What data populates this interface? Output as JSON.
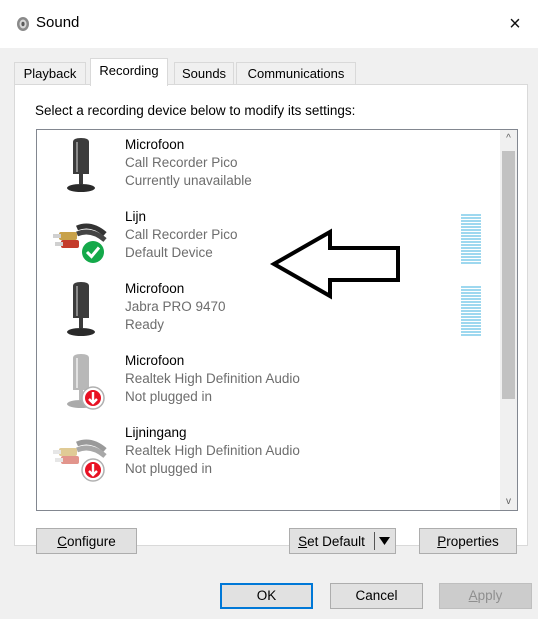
{
  "window": {
    "title": "Sound",
    "close_glyph": "×"
  },
  "tabs": [
    {
      "label": "Playback",
      "active": false
    },
    {
      "label": "Recording",
      "active": true
    },
    {
      "label": "Sounds",
      "active": false
    },
    {
      "label": "Communications",
      "active": false
    }
  ],
  "instruction": "Select a recording device below to modify its settings:",
  "devices": [
    {
      "name": "Microfoon",
      "description": "Call Recorder Pico",
      "status": "Currently unavailable",
      "icon": "microphone-icon"
    },
    {
      "name": "Lijn",
      "description": "Call Recorder Pico",
      "status": "Default Device",
      "icon": "line-in-cable-icon",
      "badge": "default-check-icon"
    },
    {
      "name": "Microfoon",
      "description": "Jabra PRO 9470",
      "status": "Ready",
      "icon": "microphone-icon"
    },
    {
      "name": "Microfoon",
      "description": "Realtek High Definition Audio",
      "status": "Not plugged in",
      "icon": "microphone-icon",
      "badge": "unplugged-arrow-icon"
    },
    {
      "name": "Lijningang",
      "description": "Realtek High Definition Audio",
      "status": "Not plugged in",
      "icon": "line-in-cable-icon",
      "badge": "unplugged-arrow-icon"
    }
  ],
  "scrollbar": {
    "up_glyph": "^",
    "down_glyph": "v"
  },
  "buttons": {
    "configure_access": "C",
    "configure_rest": "onfigure",
    "set_default_access": "S",
    "set_default_rest": "et Default",
    "properties_access": "P",
    "properties_rest": "roperties"
  },
  "dialog_buttons": {
    "ok": "OK",
    "cancel": "Cancel",
    "apply_access": "A",
    "apply_rest": "pply"
  },
  "colors": {
    "accent": "#0078d7",
    "meter": "#9ed8ef",
    "default_badge": "#14a94a",
    "unplugged_badge": "#e81123"
  }
}
